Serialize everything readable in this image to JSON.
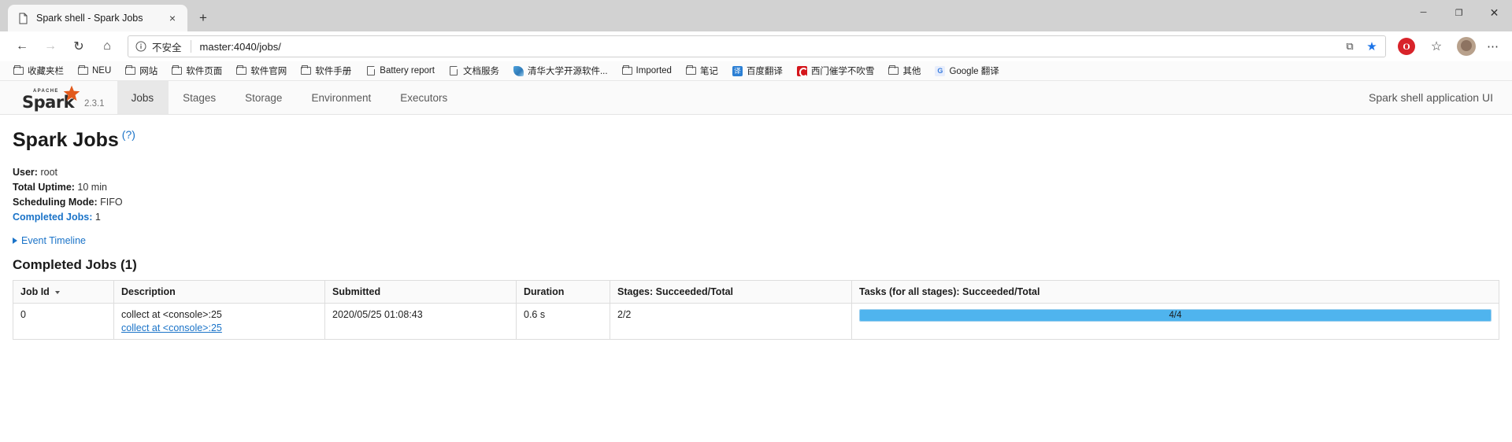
{
  "browser": {
    "tab": {
      "title": "Spark shell - Spark Jobs",
      "favicon": "page-icon",
      "close": "×"
    },
    "new_tab": "+",
    "window_controls": {
      "minimize": "─",
      "maximize": "❐",
      "close": "✕"
    },
    "nav": {
      "back": "←",
      "forward": "→",
      "reload": "↻",
      "home": "⌂",
      "security_icon": "info-icon",
      "security_text": "不安全",
      "url": "master:4040/jobs/",
      "reading_view": "⧉",
      "favorite": "★",
      "opera_badge": "O",
      "collections": "☆",
      "profile": "avatar",
      "more": "⋯"
    },
    "bookmarks": [
      {
        "label": "收藏夹栏",
        "icon": "folder-icon"
      },
      {
        "label": "NEU",
        "icon": "folder-icon"
      },
      {
        "label": "网站",
        "icon": "folder-icon"
      },
      {
        "label": "软件页面",
        "icon": "folder-icon"
      },
      {
        "label": "软件官网",
        "icon": "folder-icon"
      },
      {
        "label": "软件手册",
        "icon": "folder-icon"
      },
      {
        "label": "Battery report",
        "icon": "page-icon"
      },
      {
        "label": "文档服务",
        "icon": "page-icon"
      },
      {
        "label": "清华大学开源软件...",
        "icon": "tsinghua-icon"
      },
      {
        "label": "Imported",
        "icon": "folder-icon"
      },
      {
        "label": "笔记",
        "icon": "folder-icon"
      },
      {
        "label": "百度翻译",
        "icon": "baidu-translate-icon",
        "glyph": "译"
      },
      {
        "label": "西门催学不吹雪",
        "icon": "red-c-icon"
      },
      {
        "label": "其他",
        "icon": "folder-icon"
      },
      {
        "label": "Google 翻译",
        "icon": "google-translate-icon",
        "glyph": "G"
      }
    ]
  },
  "spark": {
    "brand": {
      "name": "Spark",
      "apache": "APACHE",
      "version": "2.3.1"
    },
    "nav_tabs": [
      {
        "label": "Jobs",
        "active": true
      },
      {
        "label": "Stages",
        "active": false
      },
      {
        "label": "Storage",
        "active": false
      },
      {
        "label": "Environment",
        "active": false
      },
      {
        "label": "Executors",
        "active": false
      }
    ],
    "app_label": "Spark shell application UI",
    "page_title": "Spark Jobs",
    "page_title_help": "(?)",
    "summary": [
      {
        "label": "User:",
        "value": "root",
        "link": false
      },
      {
        "label": "Total Uptime:",
        "value": "10 min",
        "link": false
      },
      {
        "label": "Scheduling Mode:",
        "value": "FIFO",
        "link": false
      },
      {
        "label": "Completed Jobs:",
        "value": "1",
        "link": true
      }
    ],
    "event_timeline": "Event Timeline",
    "section_title": "Completed Jobs (1)",
    "table": {
      "headers": [
        "Job Id",
        "Description",
        "Submitted",
        "Duration",
        "Stages: Succeeded/Total",
        "Tasks (for all stages): Succeeded/Total"
      ],
      "sorted_column": 0,
      "rows": [
        {
          "job_id": "0",
          "description": "collect at <console>:25",
          "description_link": "collect at <console>:25",
          "submitted": "2020/05/25 01:08:43",
          "duration": "0.6 s",
          "stages": "2/2",
          "tasks_text": "4/4",
          "tasks_percent": 100
        }
      ]
    },
    "colors": {
      "link": "#1a73c8",
      "progress_fill": "#4fb4ee",
      "progress_track": "#cfe8f7",
      "accent": "#e25a1c"
    }
  }
}
